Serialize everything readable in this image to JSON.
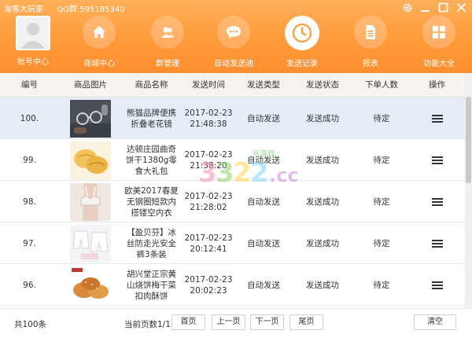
{
  "window": {
    "app_title": "淘客大玩家",
    "qq_group": "QQ群:595185340",
    "controls": [
      "gear-icon",
      "minimize-icon",
      "maximize-icon",
      "close-icon"
    ]
  },
  "nav": [
    {
      "label": "账号中心",
      "icon": "avatar-icon"
    },
    {
      "label": "商城中心",
      "icon": "home-icon"
    },
    {
      "label": "群管理",
      "icon": "users-icon"
    },
    {
      "label": "自动发送池",
      "icon": "chat-icon"
    },
    {
      "label": "发送记录",
      "icon": "clock-icon",
      "active": true
    },
    {
      "label": "报表",
      "icon": "document-icon"
    },
    {
      "label": "功能大全",
      "icon": "grid-icon"
    }
  ],
  "table": {
    "headers": [
      "编号",
      "商品图片",
      "商品名称",
      "发送时间",
      "发送类型",
      "发送状态",
      "下单人数",
      "操作"
    ],
    "rows": [
      {
        "id": "100.",
        "name": "熊猫品牌便携折叠老花镜",
        "date": "2017-02-23",
        "time": "21:48:38",
        "type": "自动发送",
        "status": "发送成功",
        "orders": "待定",
        "image": "glasses-photo"
      },
      {
        "id": "99.",
        "name": "达顿庄园曲奇饼干1380g零食大礼包",
        "date": "2017-02-23",
        "time": "21:38:20",
        "type": "自动发送",
        "status": "发送成功",
        "orders": "待定",
        "image": "cookies-photo"
      },
      {
        "id": "98.",
        "name": "欧美2017春夏无钢圈短款内搭镂空内衣",
        "date": "2017-02-23",
        "time": "21:28:02",
        "type": "自动发送",
        "status": "发送成功",
        "orders": "待定",
        "image": "lingerie-photo"
      },
      {
        "id": "97.",
        "name": "【盈贝芬】冰丝防走光安全裤3条装",
        "date": "2017-02-23",
        "time": "20:12:41",
        "type": "自动发送",
        "status": "发送成功",
        "orders": "待定",
        "image": "shorts-photo"
      },
      {
        "id": "96.",
        "name": "胡兴堂正宗黄山烧饼梅干菜扣肉酥饼",
        "date": "2017-02-23",
        "time": "20:02:23",
        "type": "自动发送",
        "status": "发送成功",
        "orders": "待定",
        "image": "pastry-photo"
      }
    ],
    "selected_row": 0
  },
  "footer": {
    "total": "共100条",
    "page": "当前页数1/1",
    "first": "首页",
    "prev": "上一页",
    "next": "下一页",
    "last": "尾页",
    "clear": "清空"
  },
  "watermark": {
    "main": "3322.cc",
    "sub": "当游戏"
  },
  "colors": {
    "header": "#ff9a3a",
    "selected_row": "#e5eef8",
    "table_header": "#f7f3ef"
  }
}
